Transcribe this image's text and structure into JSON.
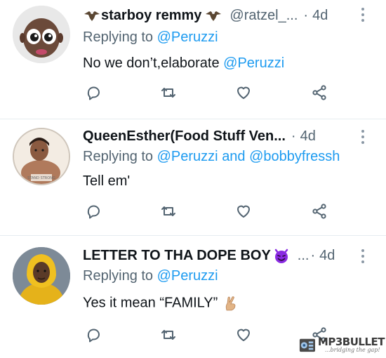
{
  "tweets": [
    {
      "name": "starboy remmy",
      "handle": "@ratzel_...",
      "dot": "·",
      "time": "4d",
      "reply_prefix": "Replying to",
      "reply_to": "@Peruzzi",
      "text": "No we don’t,elaborate",
      "text_mention": "@Peruzzi",
      "name_emoji": "eagle-emoji"
    },
    {
      "name": "QueenEsther(Food Stuff Ven...",
      "dot": "·",
      "time": "4d",
      "reply_prefix": "Replying to",
      "reply_to": "@Peruzzi",
      "reply_and": "and",
      "reply_to_2": "@bobbyfressh",
      "text": "Tell em'",
      "avatar_text": "STAND STRONG"
    },
    {
      "name": "LETTER TO THA DOPE BOY",
      "ellipsis": "...",
      "dot": "·",
      "time": "4d",
      "reply_prefix": "Replying to",
      "reply_to": "@Peruzzi",
      "text": "Yes it mean “FAMILY”",
      "name_emoji": "smiling-devil-emoji",
      "text_emoji": "crossed-fingers-emoji"
    }
  ],
  "icons": {
    "reply": "reply-icon",
    "retweet": "retweet-icon",
    "like": "heart-icon",
    "share": "share-icon",
    "more": "more-vertical-icon"
  },
  "watermark": {
    "main": "MP3BULLET",
    "sub": "...bridging the gap!"
  },
  "colors": {
    "accent": "#1d9bf0",
    "secondary_text": "#536471",
    "primary_text": "#0f1419",
    "devil": "#8a2be2"
  }
}
